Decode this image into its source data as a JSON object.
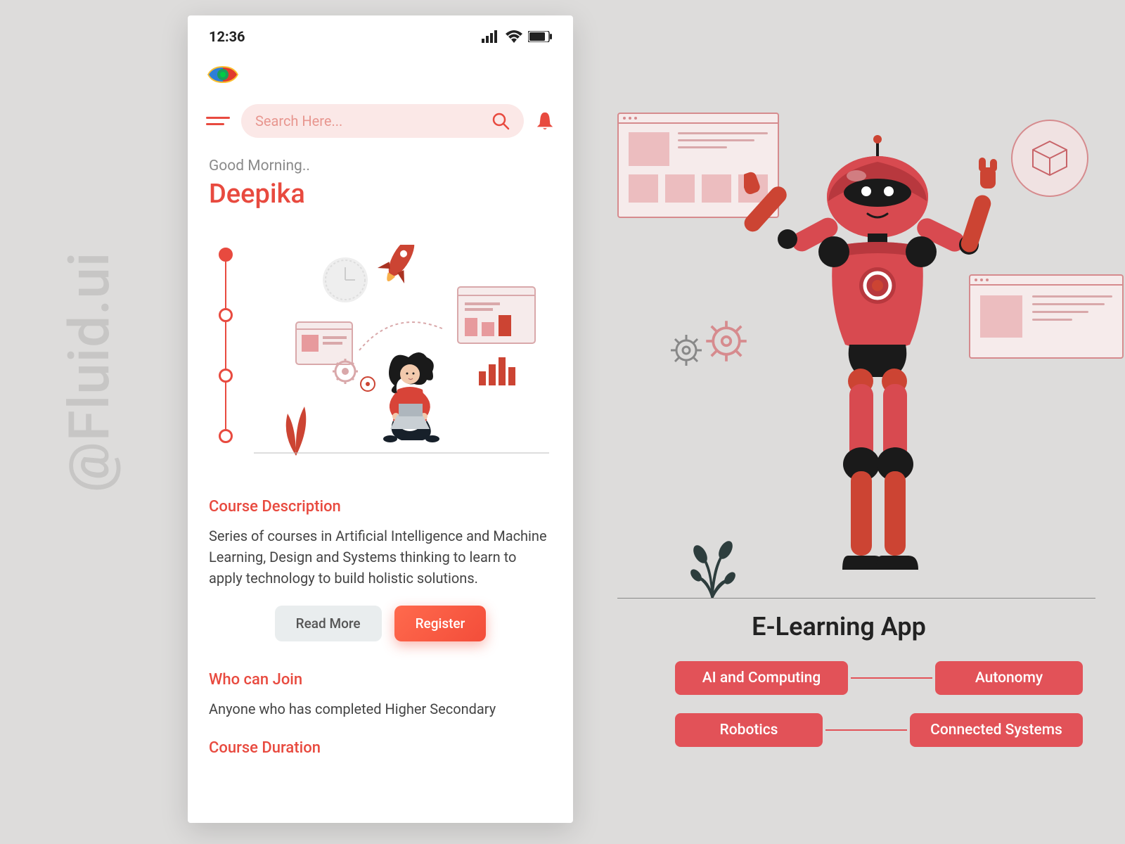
{
  "watermark": "@Fluid.ui",
  "status": {
    "time": "12:36"
  },
  "search": {
    "placeholder": "Search Here..."
  },
  "greeting": {
    "prefix": "Good Morning..",
    "name": "Deepika"
  },
  "sections": {
    "description_title": "Course Description",
    "description_body": "Series of courses in Artificial Intelligence and Machine Learning, Design and Systems thinking to learn to apply technology to build holistic solutions.",
    "who_title": "Who can Join",
    "who_body": "Anyone who has completed Higher Secondary",
    "duration_title": "Course Duration"
  },
  "buttons": {
    "read_more": "Read More",
    "register": "Register"
  },
  "right": {
    "title": "E-Learning App",
    "tags": [
      "AI and Computing",
      "Autonomy",
      "Robotics",
      "Connected Systems"
    ]
  }
}
